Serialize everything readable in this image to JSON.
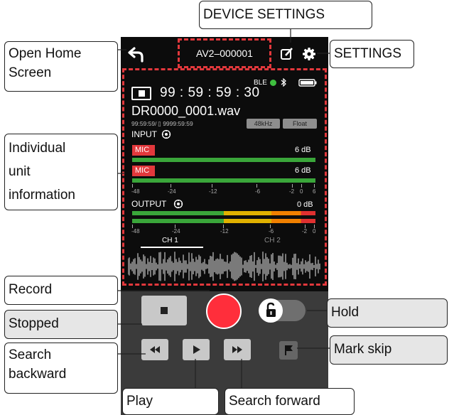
{
  "top_bar": {
    "device_name": "AV2–000001",
    "back_icon": "back-arrow-icon",
    "edit_icon": "edit-icon",
    "settings_icon": "gear-icon"
  },
  "status": {
    "ble_label": "BLE",
    "ble_color": "#3fbf3f",
    "time": "99 : 59 : 59 : 30",
    "filename": "DR0000_0001.wav",
    "remaining": "99:59:59/ ▯ 9999:59:59",
    "sample_rate": "48kHz",
    "bit_depth": "Float"
  },
  "input": {
    "label": "INPUT",
    "channels": [
      {
        "name": "MIC",
        "gain": "6 dB"
      },
      {
        "name": "MIC",
        "gain": "6 dB"
      }
    ],
    "scale": [
      "-48",
      "-24",
      "-12",
      "-6",
      "-2",
      "0",
      "6"
    ]
  },
  "output": {
    "label": "OUTPUT",
    "gain": "0 dB",
    "scale": [
      "-48",
      "-24",
      "-12",
      "-6",
      "-2",
      "0"
    ],
    "ch1": "CH 1",
    "ch2": "CH 2"
  },
  "colors": {
    "accent_red": "#e2383c",
    "meter_green": "#3aa63a",
    "meter_yellow": "#e0b100",
    "meter_orange": "#f08000",
    "meter_red": "#e03030"
  },
  "callouts": {
    "device_settings": "DEVICE SETTINGS",
    "open_home_line1": "Open Home",
    "open_home_line2": "Screen",
    "settings": "SETTINGS",
    "unit_info_line1": "Individual",
    "unit_info_line2": "unit",
    "unit_info_line3": "information",
    "record": "Record",
    "stopped": "Stopped",
    "hold": "Hold",
    "search_backward_line1": "Search",
    "search_backward_line2": "backward",
    "mark_skip": "Mark skip",
    "play": "Play",
    "search_forward": "Search forward"
  }
}
